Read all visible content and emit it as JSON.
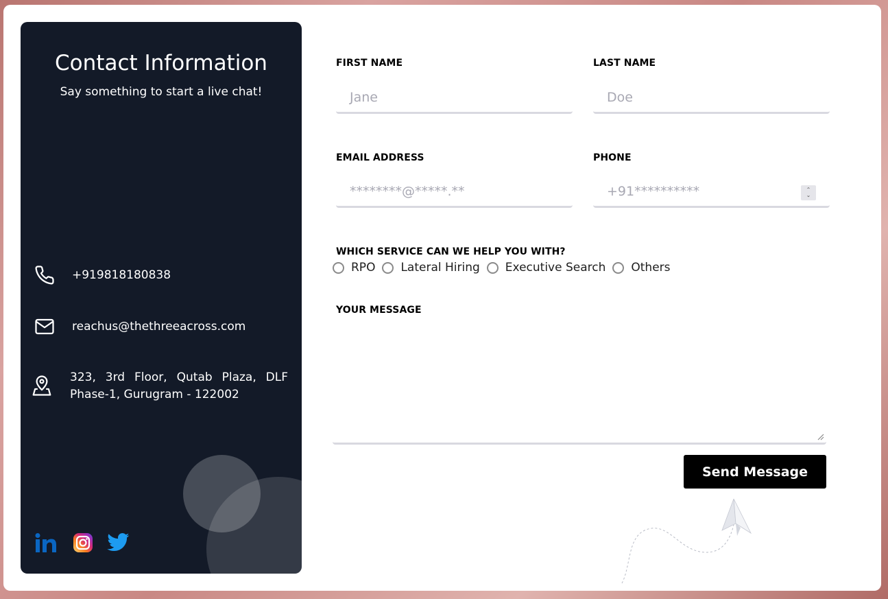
{
  "contact_info": {
    "title": "Contact Information",
    "subtitle": "Say something to start a live chat!",
    "phone": "+919818180838",
    "email": "reachus@thethreeacross.com",
    "address": "323, 3rd Floor, Qutab Plaza, DLF Phase-1, Gurugram - 122002",
    "icons": [
      "phone-icon",
      "mail-icon",
      "location-pin-icon"
    ],
    "social": [
      "linkedin-icon",
      "instagram-icon",
      "twitter-icon"
    ]
  },
  "form": {
    "first_name": {
      "label": "FIRST NAME",
      "placeholder": "Jane"
    },
    "last_name": {
      "label": "LAST NAME",
      "placeholder": "Doe"
    },
    "email": {
      "label": "EMAIL ADDRESS",
      "placeholder": "********@*****.**"
    },
    "phone": {
      "label": "PHONE",
      "placeholder": "+91**********"
    },
    "service": {
      "label": "WHICH SERVICE CAN WE HELP YOU WITH?",
      "options": [
        "RPO",
        "Lateral Hiring",
        "Executive Search",
        "Others"
      ]
    },
    "message": {
      "label": "YOUR MESSAGE",
      "value": ""
    },
    "submit_label": "Send Message"
  },
  "colors": {
    "panel": "#131a28",
    "button": "#000000",
    "linkedin": "#0a66c2",
    "twitter": "#1d9bf0"
  }
}
